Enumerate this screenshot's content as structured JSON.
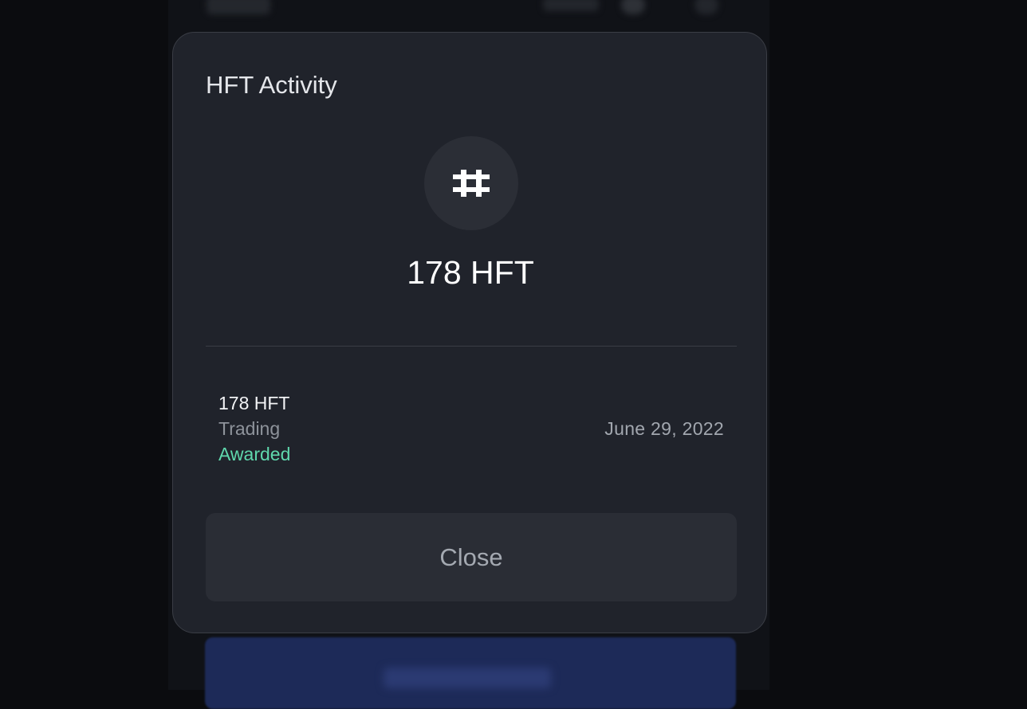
{
  "modal": {
    "title": "HFT Activity",
    "token_icon": "hashflow-icon",
    "amount": "178 HFT",
    "close_label": "Close"
  },
  "activity": {
    "amount": "178 HFT",
    "type": "Trading",
    "status": "Awarded",
    "date": "June 29, 2022"
  },
  "colors": {
    "modal_background": "#20232b",
    "status_awarded": "#5fd8ad",
    "backdrop": "#0b0c0f"
  }
}
